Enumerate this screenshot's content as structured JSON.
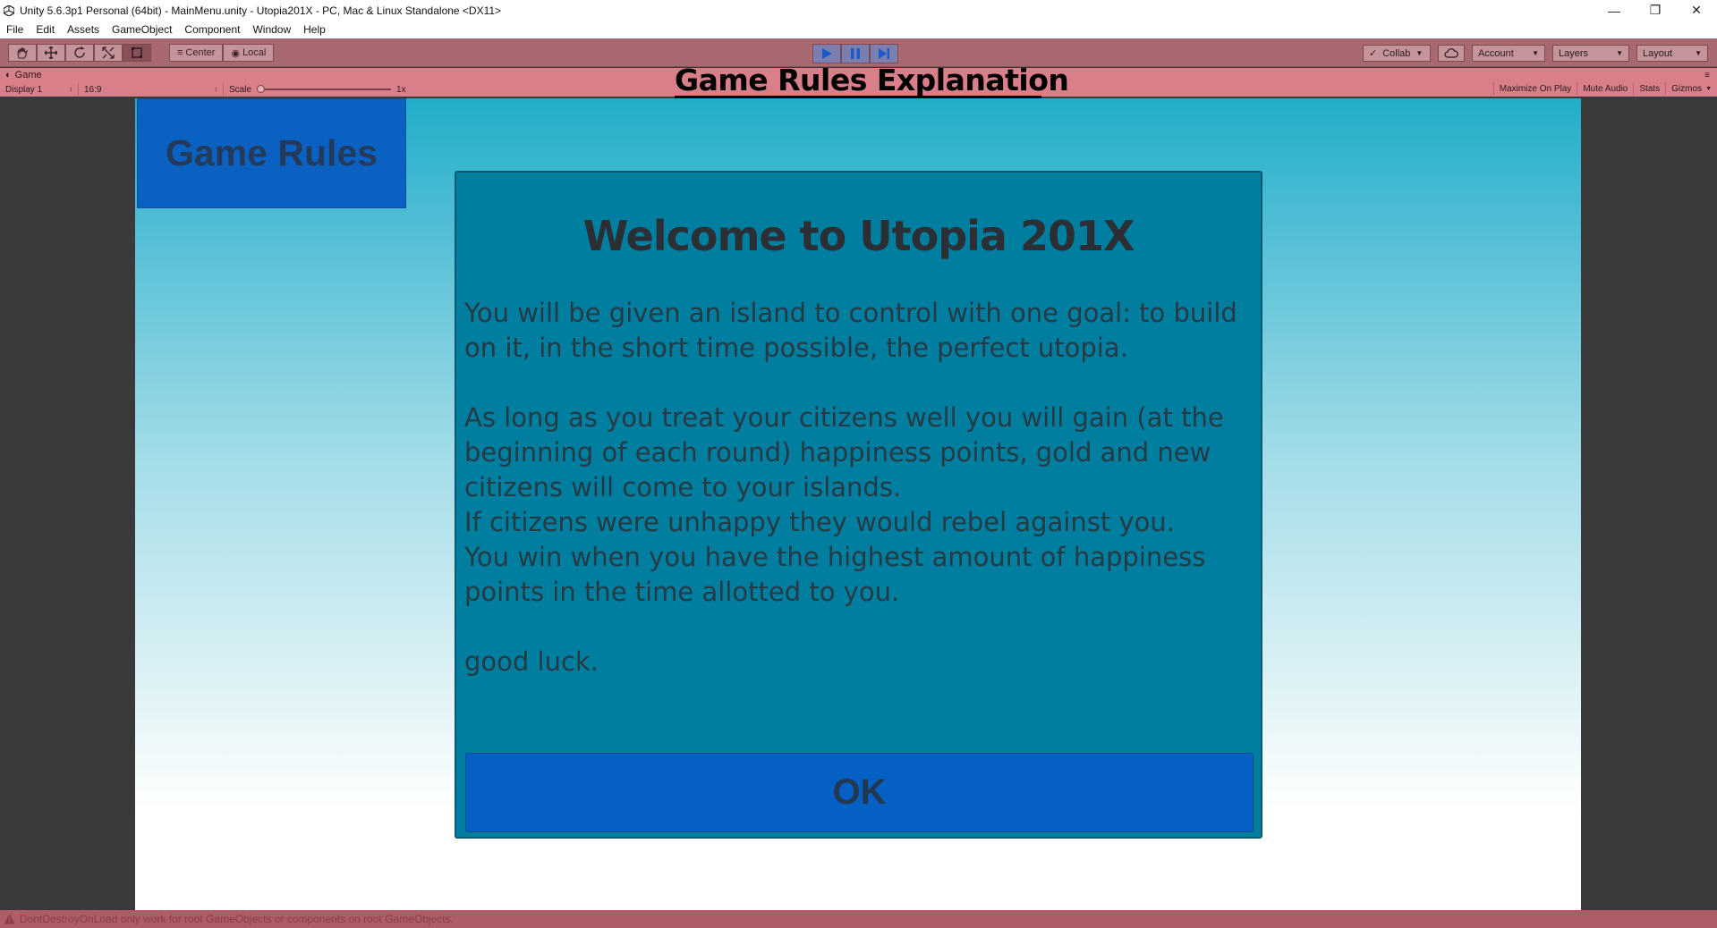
{
  "window": {
    "title": "Unity 5.6.3p1 Personal (64bit) - MainMenu.unity - Utopia201X - PC, Mac & Linux Standalone <DX11>"
  },
  "menu": [
    "File",
    "Edit",
    "Assets",
    "GameObject",
    "Component",
    "Window",
    "Help"
  ],
  "toolbar": {
    "center_label": "Center",
    "local_label": "Local",
    "collab_label": "Collab",
    "account_label": "Account",
    "layers_label": "Layers",
    "layout_label": "Layout"
  },
  "game_view": {
    "tab_label": "Game",
    "display_label": "Display 1",
    "aspect_label": "16:9",
    "scale_label": "Scale",
    "scale_value": "1x",
    "maximize_label": "Maximize On Play",
    "mute_label": "Mute Audio",
    "stats_label": "Stats",
    "gizmos_label": "Gizmos"
  },
  "page_heading": "Game Rules Explanation",
  "game": {
    "rules_tab_label": "Game Rules",
    "dialog": {
      "title": "Welcome to Utopia 201X",
      "paragraph1": "You will be given an island to control with one goal: to build on it, in the short time possible, the perfect utopia.",
      "paragraph2": "As long as you treat your citizens well you will gain (at the beginning of each round) happiness points, gold and new citizens will come to your islands.",
      "paragraph3": "If citizens were unhappy they would rebel against you.",
      "paragraph4": "You win when you have the highest amount of happiness points in the time allotted to you.",
      "paragraph5": "good luck.",
      "ok_label": "OK"
    }
  },
  "status": {
    "message": "DontDestroyOnLoad only work for root GameObjects or components on root GameObjects."
  },
  "colors": {
    "toolbar": "#a86870",
    "game_header": "#d87f8a",
    "dialog_bg": "#007ea0",
    "button_bg": "#0560c4",
    "status_bar": "#ae5c66"
  }
}
